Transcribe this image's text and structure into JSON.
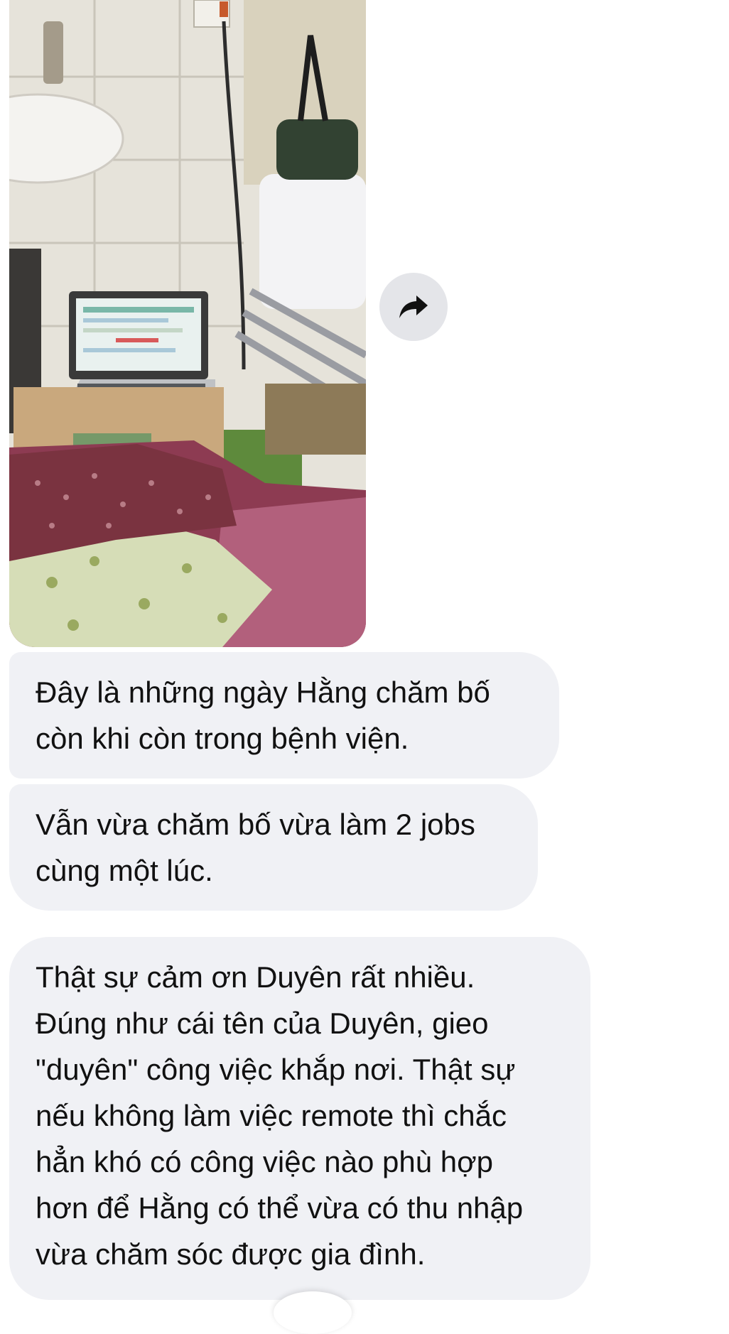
{
  "photo": {
    "icon": "photo-thumbnail"
  },
  "forward": {
    "icon": "share-forward-arrow-icon"
  },
  "messages": [
    {
      "lines": [
        "Đây là những ngày Hằng chăm bố",
        "còn khi còn trong bệnh viện."
      ]
    },
    {
      "lines": [
        "Vẫn vừa chăm bố vừa làm 2 jobs",
        "cùng một lúc."
      ]
    },
    {
      "lines": [
        "Thật sự cảm ơn Duyên rất nhiều.",
        "Đúng như cái tên của Duyên, gieo",
        "\"duyên\" công việc khắp nơi. Thật sự",
        "nếu không làm việc remote thì chắc",
        "hẳn khó có công việc nào phù hợp",
        "hơn để Hằng có thể vừa có thu nhập",
        "vừa chăm sóc được gia đình."
      ]
    }
  ],
  "colors": {
    "bubble": "#f0f1f5",
    "forward_button": "#e4e5e9",
    "text": "#111111"
  }
}
